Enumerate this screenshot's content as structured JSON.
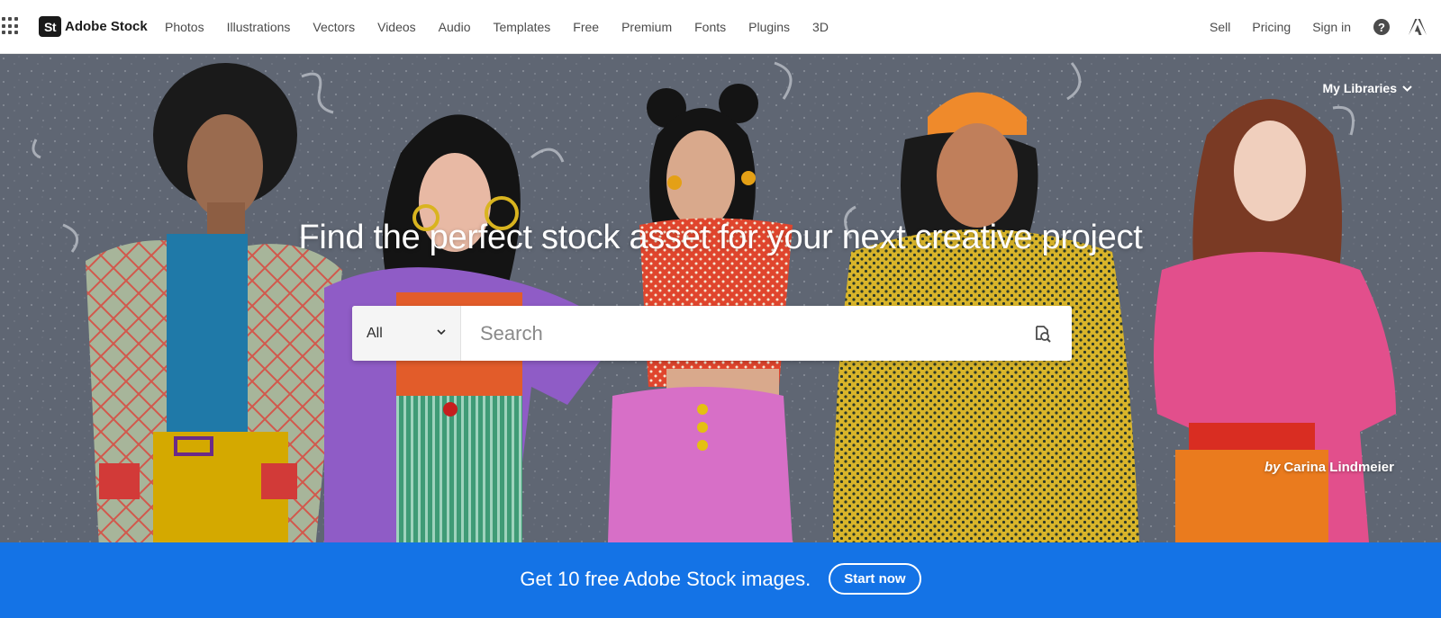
{
  "nav": {
    "brand_mark": "St",
    "brand_name": "Adobe Stock",
    "links": [
      "Photos",
      "Illustrations",
      "Vectors",
      "Videos",
      "Audio",
      "Templates",
      "Free",
      "Premium",
      "Fonts",
      "Plugins",
      "3D"
    ],
    "sell": "Sell",
    "pricing": "Pricing",
    "sign_in": "Sign in",
    "help_icon": "?",
    "icons": {
      "apps": "app-grid-icon",
      "help": "help-icon",
      "adobe": "adobe-logo-icon"
    }
  },
  "hero": {
    "my_libraries": "My Libraries",
    "headline": "Find the perfect stock asset for your next creative project",
    "search": {
      "scope": "All",
      "placeholder": "Search",
      "value": ""
    },
    "credit_by": "by",
    "credit_name": "Carina Lindmeier"
  },
  "promo": {
    "text": "Get 10 free Adobe Stock images.",
    "button": "Start now"
  },
  "colors": {
    "promo_bg": "#1473e6",
    "hero_bg": "#5d6472",
    "nav_text": "#4b4b4b"
  }
}
